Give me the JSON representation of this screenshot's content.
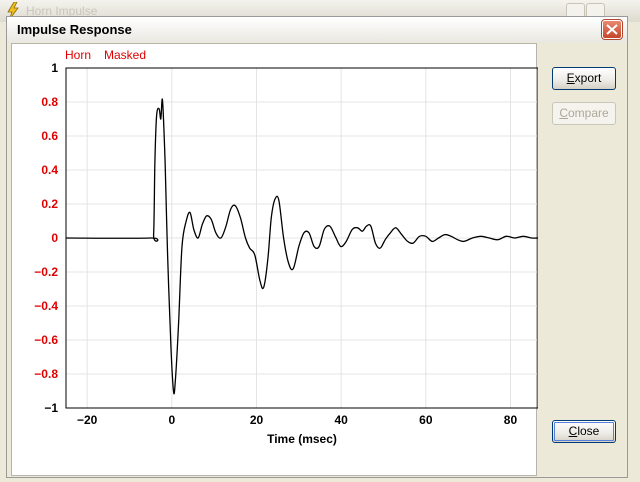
{
  "background_window": {
    "title": "Horn Impulse"
  },
  "dialog": {
    "title": "Impulse Response",
    "close_icon": "close-x-icon"
  },
  "buttons": {
    "export_hot": "E",
    "export_rest": "xport",
    "compare_hot": "C",
    "compare_rest": "ompare",
    "close_hot": "C",
    "close_rest": "lose"
  },
  "legend": [
    {
      "name": "Horn",
      "color": "#e00000"
    },
    {
      "name": "Masked",
      "color": "#e00000"
    }
  ],
  "colors": {
    "tick_labels_y": "#e00000",
    "trace": "#000000",
    "grid": "#e4e4e4"
  },
  "chart_data": {
    "type": "line",
    "xlabel": "Time (msec)",
    "ylabel": "",
    "xlim": [
      -25,
      86.5
    ],
    "ylim": [
      -1,
      1
    ],
    "xticks": [
      -20,
      0,
      20,
      40,
      60,
      80
    ],
    "yticks": [
      1,
      0.8,
      0.6,
      0.4,
      0.2,
      0,
      -0.2,
      -0.4,
      -0.6,
      -0.8,
      -1
    ],
    "grid": true,
    "series": [
      {
        "name": "Horn",
        "x": [
          -25,
          -5,
          -4.3,
          -4,
          -3.6,
          -3,
          -2.6,
          -2.2,
          -1.6,
          -1,
          -0.2,
          0.4,
          0.8,
          1.6,
          2.4,
          3.4,
          4.3,
          5.2,
          6.2,
          7.2,
          8.2,
          9.3,
          10.4,
          11.6,
          12.8,
          13.9,
          15,
          16.2,
          17.4,
          18.4,
          19.6,
          20.8,
          21.7,
          22.7,
          23.5,
          24.4,
          25.3,
          26.4,
          27.6,
          28.7,
          30,
          31.2,
          32.4,
          33.6,
          34.8,
          36,
          37.3,
          38.6,
          39.9,
          41.2,
          42.6,
          43.9,
          45,
          46,
          47,
          48.1,
          49.2,
          50.4,
          51.6,
          52.9,
          54.3,
          55.7,
          57,
          58.5,
          60,
          61.5,
          63,
          64.5,
          66,
          67.5,
          69,
          71,
          73,
          75,
          77,
          79,
          81,
          83,
          85,
          86.5
        ],
        "y": [
          0,
          0,
          0.02,
          0.45,
          0.72,
          0.76,
          0.7,
          0.81,
          0.45,
          -0.1,
          -0.65,
          -0.9,
          -0.85,
          -0.5,
          -0.05,
          0.1,
          0.15,
          0.05,
          0.0,
          0.08,
          0.13,
          0.11,
          0.03,
          0.0,
          0.07,
          0.17,
          0.19,
          0.12,
          0.0,
          -0.06,
          -0.1,
          -0.25,
          -0.29,
          -0.12,
          0.12,
          0.23,
          0.22,
          0.0,
          -0.15,
          -0.18,
          -0.05,
          0.03,
          0.03,
          -0.05,
          -0.05,
          0.05,
          0.07,
          0.01,
          -0.05,
          -0.02,
          0.05,
          0.06,
          0.04,
          0.07,
          0.07,
          -0.03,
          -0.06,
          -0.01,
          0.03,
          0.06,
          0.02,
          -0.02,
          -0.03,
          0.01,
          0.01,
          -0.02,
          0.0,
          0.02,
          0.01,
          -0.01,
          -0.02,
          0.0,
          0.01,
          0.0,
          -0.01,
          0.01,
          0.0,
          0.01,
          0.0,
          0.0
        ]
      }
    ]
  }
}
